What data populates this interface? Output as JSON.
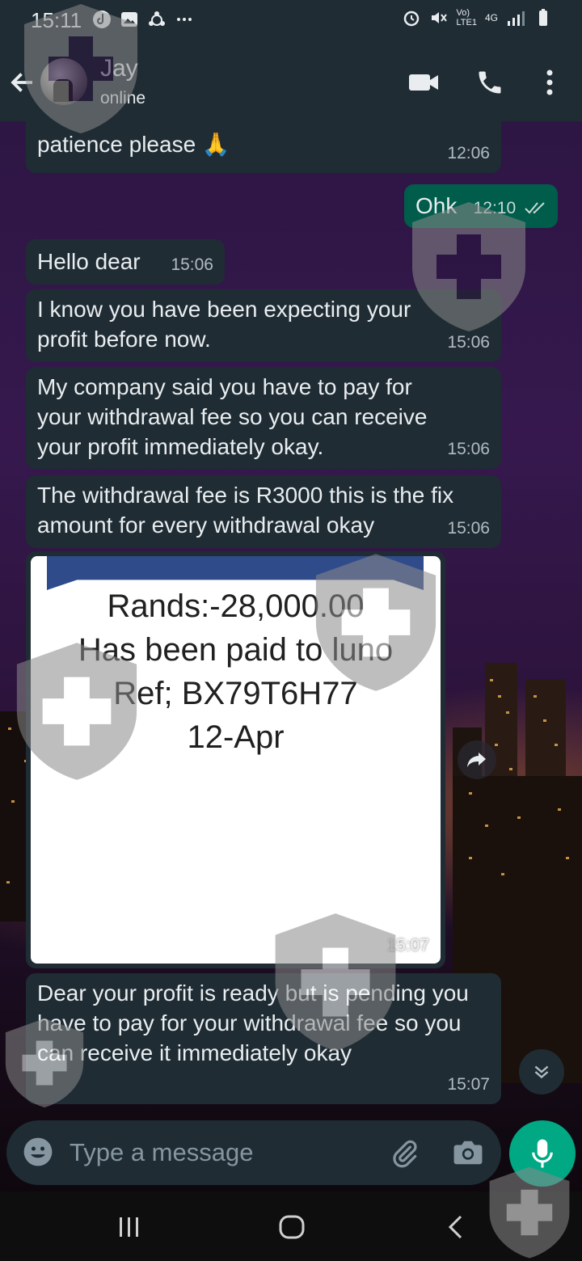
{
  "status_bar": {
    "time": "15:11",
    "volte": "Vo)",
    "lte": "LTE1",
    "network": "4G"
  },
  "header": {
    "contact_name": "Jay",
    "contact_status": "online"
  },
  "messages": [
    {
      "direction": "in",
      "text": "patience please 🙏",
      "time": "12:06"
    },
    {
      "direction": "out",
      "text": "Ohk",
      "time": "12:10",
      "status": "read"
    },
    {
      "direction": "in",
      "text": "Hello dear",
      "time": "15:06"
    },
    {
      "direction": "in",
      "text": "I know you have been expecting your profit before now.",
      "time": "15:06"
    },
    {
      "direction": "in",
      "text": "My company said you have to pay for your withdrawal fee so you can receive your profit immediately okay.",
      "time": "15:06"
    },
    {
      "direction": "in",
      "text": "The withdrawal fee is R3000 this is the fix amount for every withdrawal okay",
      "time": "15:06"
    },
    {
      "direction": "in",
      "type": "image",
      "time": "15:07",
      "image_text": [
        "Rands:-28,000.00",
        "Has been paid to luno",
        "Ref; BX79T6H77",
        "12-Apr"
      ]
    },
    {
      "direction": "in",
      "text": "Dear your profit is ready but is pending you have to pay for your withdrawal fee so you can receive it immediately okay",
      "time": "15:07"
    }
  ],
  "composer": {
    "placeholder": "Type a message"
  },
  "colors": {
    "header_bg": "#1f2c34",
    "incoming_bubble": "#1f2c34",
    "outgoing_bubble": "#005c4b",
    "accent": "#00a884"
  },
  "icons": {
    "back": "arrow-left-icon",
    "video": "video-camera-icon",
    "call": "phone-icon",
    "menu": "more-vertical-icon",
    "emoji": "emoji-icon",
    "attach": "paperclip-icon",
    "camera": "camera-icon",
    "mic": "microphone-icon",
    "forward": "forward-icon",
    "scroll": "double-chevron-down-icon"
  }
}
